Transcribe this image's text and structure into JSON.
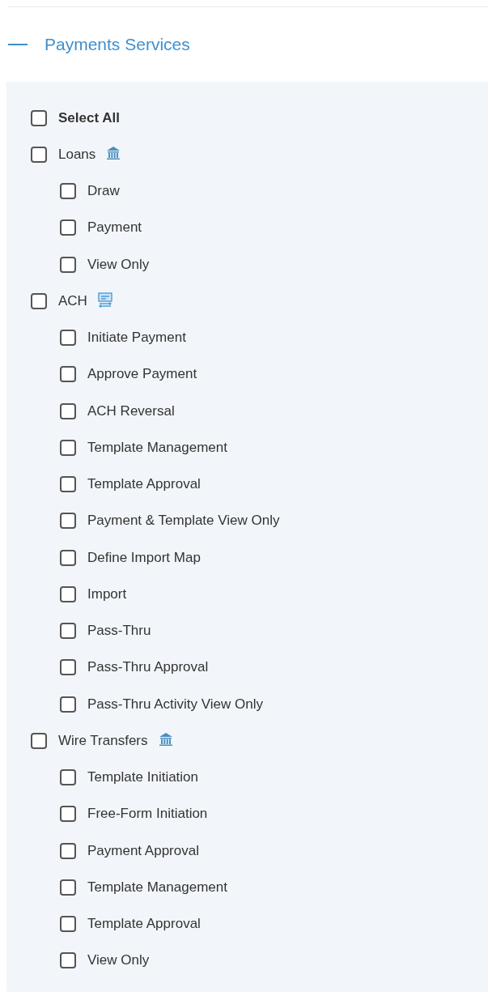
{
  "section": {
    "title": "Payments Services",
    "expanded": true
  },
  "select_all": {
    "label": "Select All",
    "checked": false
  },
  "groups": [
    {
      "label": "Loans",
      "kind": "bank",
      "checked": false,
      "children": [
        {
          "label": "Draw",
          "checked": false
        },
        {
          "label": "Payment",
          "checked": false
        },
        {
          "label": "View Only",
          "checked": false
        }
      ]
    },
    {
      "label": "ACH",
      "kind": "transfer",
      "checked": false,
      "children": [
        {
          "label": "Initiate Payment",
          "checked": false
        },
        {
          "label": "Approve Payment",
          "checked": false
        },
        {
          "label": "ACH Reversal",
          "checked": false
        },
        {
          "label": "Template Management",
          "checked": false
        },
        {
          "label": "Template Approval",
          "checked": false
        },
        {
          "label": "Payment & Template View Only",
          "checked": false
        },
        {
          "label": "Define Import Map",
          "checked": false
        },
        {
          "label": "Import",
          "checked": false
        },
        {
          "label": "Pass-Thru",
          "checked": false
        },
        {
          "label": "Pass-Thru Approval",
          "checked": false
        },
        {
          "label": "Pass-Thru Activity View Only",
          "checked": false
        }
      ]
    },
    {
      "label": "Wire Transfers",
      "kind": "bank",
      "checked": false,
      "children": [
        {
          "label": "Template Initiation",
          "checked": false
        },
        {
          "label": "Free-Form Initiation",
          "checked": false
        },
        {
          "label": "Payment Approval",
          "checked": false
        },
        {
          "label": "Template Management",
          "checked": false
        },
        {
          "label": "Template Approval",
          "checked": false
        },
        {
          "label": "View Only",
          "checked": false
        }
      ]
    }
  ]
}
